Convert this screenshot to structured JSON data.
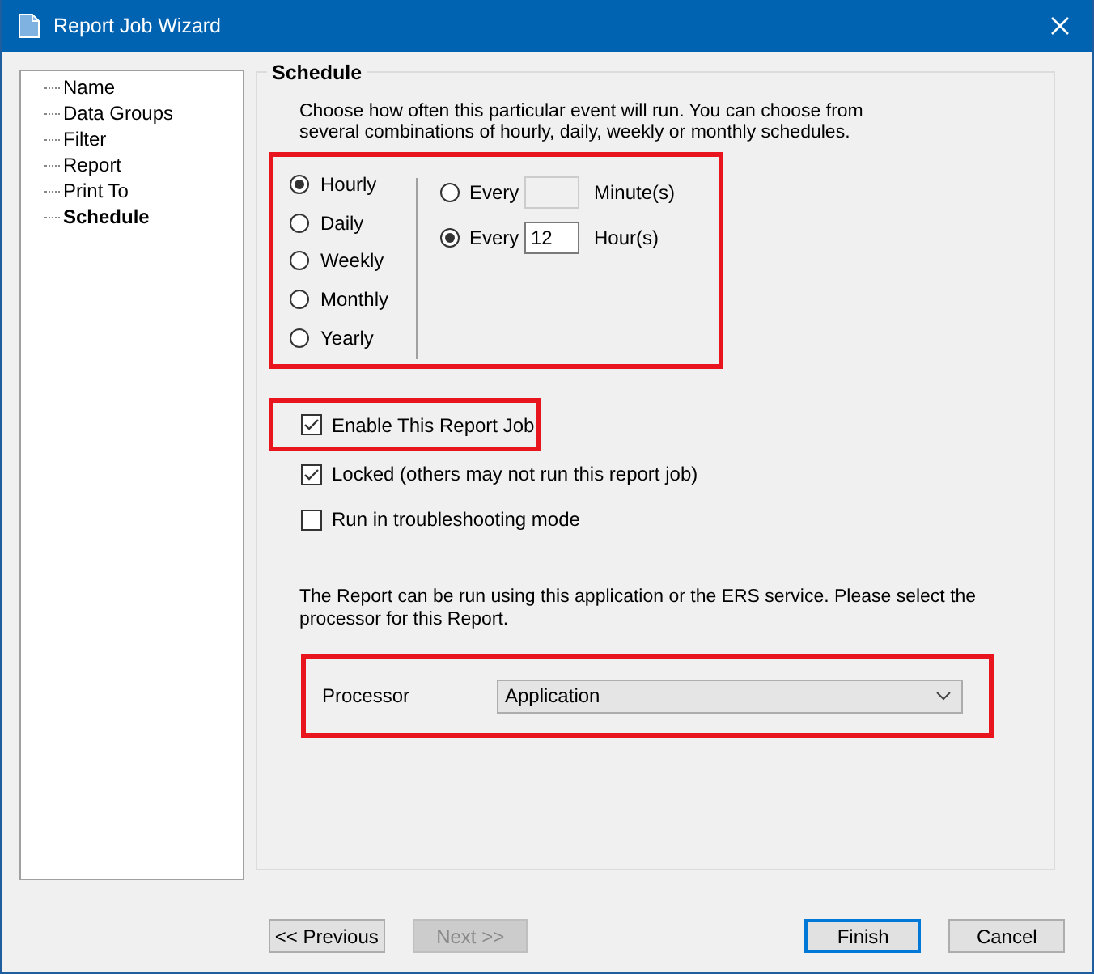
{
  "window": {
    "title": "Report Job Wizard"
  },
  "steps": [
    {
      "label": "Name",
      "selected": false
    },
    {
      "label": "Data Groups",
      "selected": false
    },
    {
      "label": "Filter",
      "selected": false
    },
    {
      "label": "Report",
      "selected": false
    },
    {
      "label": "Print To",
      "selected": false
    },
    {
      "label": "Schedule",
      "selected": true
    }
  ],
  "schedule": {
    "title": "Schedule",
    "intro": "Choose how often this particular event will run. You can choose from several combinations of hourly, daily, weekly or monthly schedules.",
    "frequency": {
      "highlighted": true,
      "options": [
        {
          "label": "Hourly",
          "selected": true
        },
        {
          "label": "Daily",
          "selected": false
        },
        {
          "label": "Weekly",
          "selected": false
        },
        {
          "label": "Monthly",
          "selected": false
        },
        {
          "label": "Yearly",
          "selected": false
        }
      ],
      "intervals": [
        {
          "prefix": "Every",
          "unit": "Minute(s)",
          "selected": false,
          "disabled": true
        },
        {
          "prefix": "Every",
          "value": "12",
          "unit": "Hour(s)",
          "selected": true,
          "disabled": false
        }
      ]
    },
    "options": [
      {
        "label": "Enable This Report Job",
        "checked": true,
        "highlighted": true
      },
      {
        "label": "Locked (others may not run this report job)",
        "checked": true,
        "highlighted": false
      },
      {
        "label": "Run in troubleshooting mode",
        "checked": false,
        "highlighted": false
      }
    ],
    "processor_note": "The Report can be run using this application or the ERS service. Please select the processor for this Report.",
    "processor": {
      "label": "Processor",
      "value": "Application",
      "highlighted": true
    }
  },
  "buttons": [
    {
      "label": "<< Previous",
      "disabled": false,
      "default": false
    },
    {
      "label": "Next >>",
      "disabled": true,
      "default": false
    },
    {
      "label": "Finish",
      "disabled": false,
      "default": true
    },
    {
      "label": "Cancel",
      "disabled": false,
      "default": false
    }
  ]
}
